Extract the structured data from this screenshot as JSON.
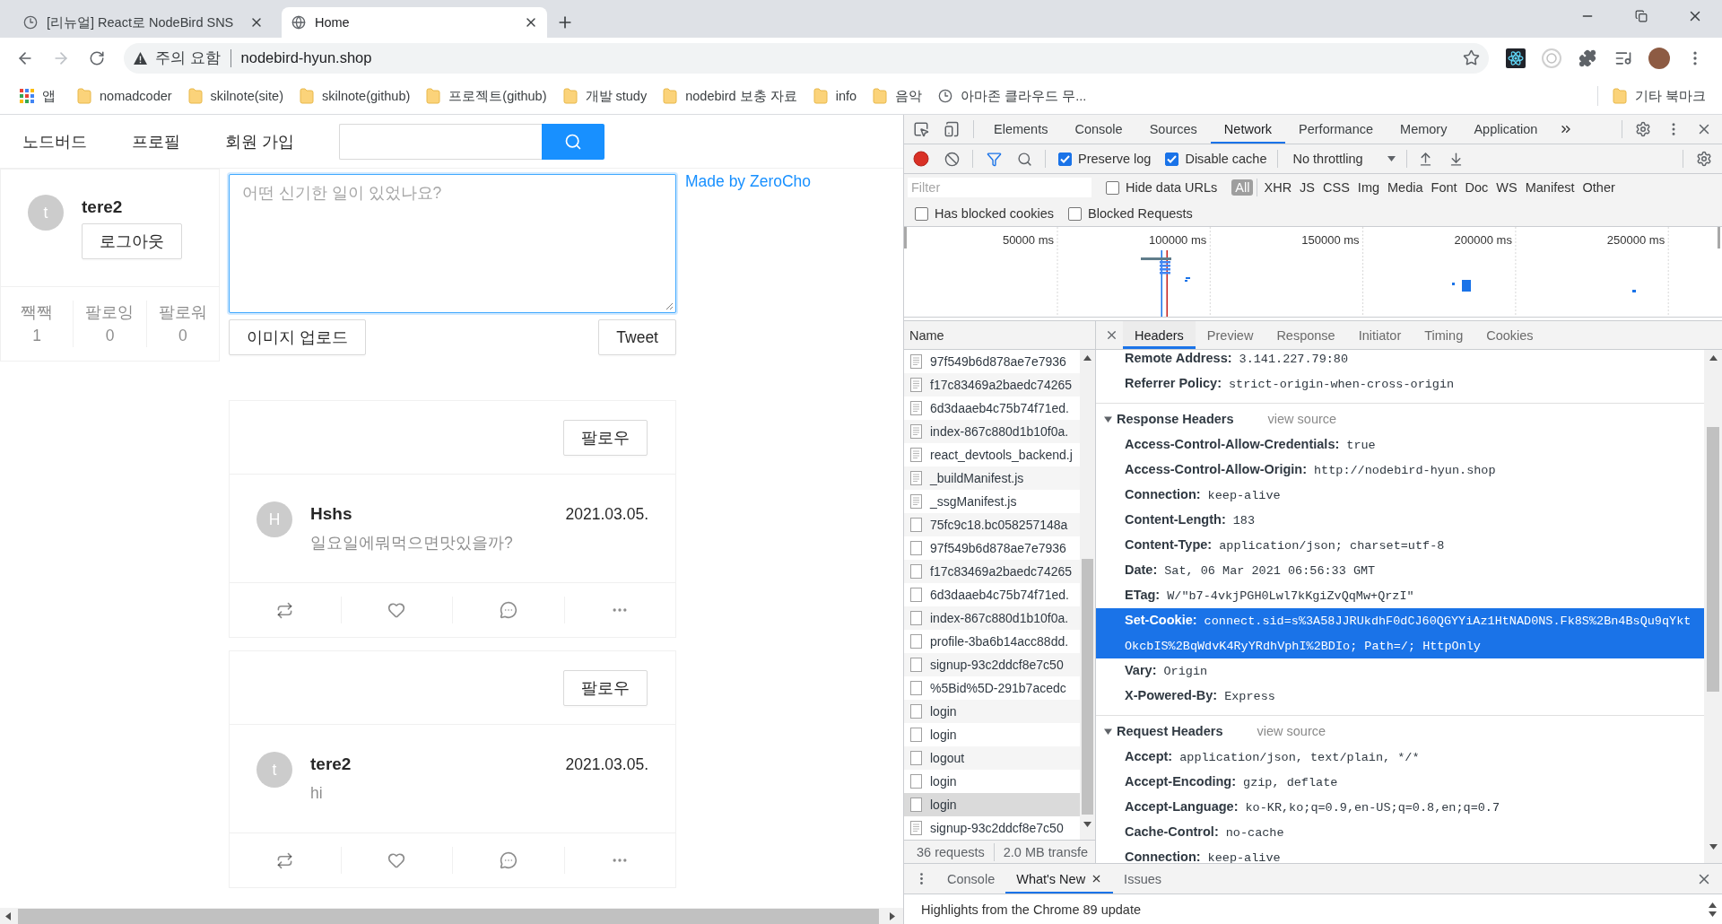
{
  "browser": {
    "tabs": [
      {
        "title": "[리뉴얼] React로 NodeBird SNS",
        "selected": false
      },
      {
        "title": "Home",
        "selected": true
      }
    ],
    "address": {
      "warning": "주의 요함",
      "url": "nodebird-hyun.shop"
    },
    "bookmarks": [
      {
        "kind": "apps",
        "label": "앱"
      },
      {
        "kind": "folder",
        "label": "nomadcoder"
      },
      {
        "kind": "folder",
        "label": "skilnote(site)"
      },
      {
        "kind": "folder",
        "label": "skilnote(github)"
      },
      {
        "kind": "folder",
        "label": "프로젝트(github)"
      },
      {
        "kind": "folder",
        "label": "개발 study"
      },
      {
        "kind": "folder",
        "label": "nodebird 보충 자료"
      },
      {
        "kind": "folder",
        "label": "info"
      },
      {
        "kind": "folder",
        "label": "음악"
      },
      {
        "kind": "page",
        "label": "아마존 클라우드 무..."
      }
    ],
    "other_bookmarks": "기타 북마크"
  },
  "page": {
    "menu": [
      "노드버드",
      "프로필",
      "회원 가입"
    ],
    "profile": {
      "avatar": "t",
      "name": "tere2",
      "logout": "로그아웃",
      "stats": [
        {
          "label": "짹짹",
          "value": "1"
        },
        {
          "label": "팔로잉",
          "value": "0"
        },
        {
          "label": "팔로워",
          "value": "0"
        }
      ]
    },
    "composer": {
      "placeholder": "어떤 신기한 일이 있었나요?",
      "upload": "이미지 업로드",
      "submit": "Tweet"
    },
    "credit": "Made by ZeroCho",
    "posts": [
      {
        "follow": "팔로우",
        "avatar": "H",
        "author": "Hshs",
        "date": "2021.03.05.",
        "content": "일요일에뭐먹으면맛있을까?",
        "liked": false
      },
      {
        "follow": "팔로우",
        "avatar": "t",
        "author": "tere2",
        "date": "2021.03.05.",
        "content": "hi",
        "liked": false
      }
    ]
  },
  "devtools": {
    "panels": [
      {
        "label": "Elements",
        "selected": false
      },
      {
        "label": "Console",
        "selected": false
      },
      {
        "label": "Sources",
        "selected": false
      },
      {
        "label": "Network",
        "selected": true
      },
      {
        "label": "Performance",
        "selected": false
      },
      {
        "label": "Memory",
        "selected": false
      },
      {
        "label": "Application",
        "selected": false
      }
    ],
    "network_toolbar": {
      "recording": true,
      "options": [
        {
          "label": "Preserve log",
          "checked": true
        },
        {
          "label": "Disable cache",
          "checked": true
        }
      ],
      "throttling": "No throttling"
    },
    "filter": {
      "placeholder": "Filter",
      "hide_data_urls": {
        "label": "Hide data URLs",
        "checked": false
      },
      "types": [
        {
          "label": "All",
          "selected": true
        },
        {
          "label": "XHR",
          "selected": false
        },
        {
          "label": "JS",
          "selected": false
        },
        {
          "label": "CSS",
          "selected": false
        },
        {
          "label": "Img",
          "selected": false
        },
        {
          "label": "Media",
          "selected": false
        },
        {
          "label": "Font",
          "selected": false
        },
        {
          "label": "Doc",
          "selected": false
        },
        {
          "label": "WS",
          "selected": false
        },
        {
          "label": "Manifest",
          "selected": false
        },
        {
          "label": "Other",
          "selected": false
        }
      ],
      "blocking": [
        {
          "label": "Has blocked cookies",
          "checked": false
        },
        {
          "label": "Blocked Requests",
          "checked": false
        }
      ]
    },
    "overview": {
      "ticks": [
        "50000 ms",
        "100000 ms",
        "150000 ms",
        "200000 ms",
        "250000 ms"
      ]
    },
    "requests": {
      "column": "Name",
      "rows": [
        {
          "name": "97f549b6d878ae7e7936",
          "kind": "script",
          "selected": false
        },
        {
          "name": "f17c83469a2baedc74265",
          "kind": "script",
          "selected": false
        },
        {
          "name": "6d3daaeb4c75b74f71ed.",
          "kind": "script",
          "selected": false
        },
        {
          "name": "index-867c880d1b10f0a.",
          "kind": "script",
          "selected": false
        },
        {
          "name": "react_devtools_backend.j",
          "kind": "script",
          "selected": false
        },
        {
          "name": "_buildManifest.js",
          "kind": "script",
          "selected": false
        },
        {
          "name": "_ssgManifest.js",
          "kind": "script",
          "selected": false
        },
        {
          "name": "75fc9c18.bc058257148a",
          "kind": "other",
          "selected": false
        },
        {
          "name": "97f549b6d878ae7e7936",
          "kind": "other",
          "selected": false
        },
        {
          "name": "f17c83469a2baedc74265",
          "kind": "other",
          "selected": false
        },
        {
          "name": "6d3daaeb4c75b74f71ed.",
          "kind": "other",
          "selected": false
        },
        {
          "name": "index-867c880d1b10f0a.",
          "kind": "other",
          "selected": false
        },
        {
          "name": "profile-3ba6b14acc88dd.",
          "kind": "other",
          "selected": false
        },
        {
          "name": "signup-93c2ddcf8e7c50",
          "kind": "other",
          "selected": false
        },
        {
          "name": "%5Bid%5D-291b7acedc",
          "kind": "other",
          "selected": false
        },
        {
          "name": "login",
          "kind": "other",
          "selected": false
        },
        {
          "name": "login",
          "kind": "other",
          "selected": false
        },
        {
          "name": "logout",
          "kind": "other",
          "selected": false
        },
        {
          "name": "login",
          "kind": "other",
          "selected": false
        },
        {
          "name": "login",
          "kind": "other",
          "selected": true
        },
        {
          "name": "signup-93c2ddcf8e7c50",
          "kind": "script",
          "selected": false
        }
      ],
      "summary": [
        "36 requests",
        "2.0 MB transfe"
      ]
    },
    "details": {
      "tabs": [
        {
          "label": "Headers",
          "selected": true
        },
        {
          "label": "Preview",
          "selected": false
        },
        {
          "label": "Response",
          "selected": false
        },
        {
          "label": "Initiator",
          "selected": false
        },
        {
          "label": "Timing",
          "selected": false
        },
        {
          "label": "Cookies",
          "selected": false
        }
      ],
      "general": [
        {
          "name": "Remote Address:",
          "value": "3.141.227.79:80",
          "selected": false
        },
        {
          "name": "Referrer Policy:",
          "value": "strict-origin-when-cross-origin",
          "selected": false
        }
      ],
      "sections": [
        {
          "title": "Response Headers",
          "link": "view source",
          "expanded": true,
          "headers": [
            {
              "name": "Access-Control-Allow-Credentials:",
              "value": "true",
              "selected": false
            },
            {
              "name": "Access-Control-Allow-Origin:",
              "value": "http://nodebird-hyun.shop",
              "selected": false
            },
            {
              "name": "Connection:",
              "value": "keep-alive",
              "selected": false
            },
            {
              "name": "Content-Length:",
              "value": "183",
              "selected": false
            },
            {
              "name": "Content-Type:",
              "value": "application/json; charset=utf-8",
              "selected": false
            },
            {
              "name": "Date:",
              "value": "Sat, 06 Mar 2021 06:56:33 GMT",
              "selected": false
            },
            {
              "name": "ETag:",
              "value": "W/\"b7-4vkjPGH0Lwl7kKgiZvQqMw+QrzI\"",
              "selected": false
            },
            {
              "name": "Set-Cookie:",
              "value": "connect.sid=s%3A58JJRUkdhF0dCJ60QGYYiAz1HtNAD0NS.Fk8S%2Bn4BsQu9qYktOkcbIS%2BqWdvK4RyYRdhVphI%2BDIo; Path=/; HttpOnly",
              "selected": true
            },
            {
              "name": "Vary:",
              "value": "Origin",
              "selected": false
            },
            {
              "name": "X-Powered-By:",
              "value": "Express",
              "selected": false
            }
          ]
        },
        {
          "title": "Request Headers",
          "link": "view source",
          "expanded": true,
          "headers": [
            {
              "name": "Accept:",
              "value": "application/json, text/plain, */*",
              "selected": false
            },
            {
              "name": "Accept-Encoding:",
              "value": "gzip, deflate",
              "selected": false
            },
            {
              "name": "Accept-Language:",
              "value": "ko-KR,ko;q=0.9,en-US;q=0.8,en;q=0.7",
              "selected": false
            },
            {
              "name": "Cache-Control:",
              "value": "no-cache",
              "selected": false
            },
            {
              "name": "Connection:",
              "value": "keep-alive",
              "selected": false
            }
          ]
        }
      ]
    },
    "drawer": {
      "tabs": [
        {
          "label": "Console",
          "selected": false,
          "closable": false
        },
        {
          "label": "What's New",
          "selected": true,
          "closable": true
        },
        {
          "label": "Issues",
          "selected": false,
          "closable": false
        }
      ],
      "content": "Highlights from the Chrome 89 update"
    }
  }
}
